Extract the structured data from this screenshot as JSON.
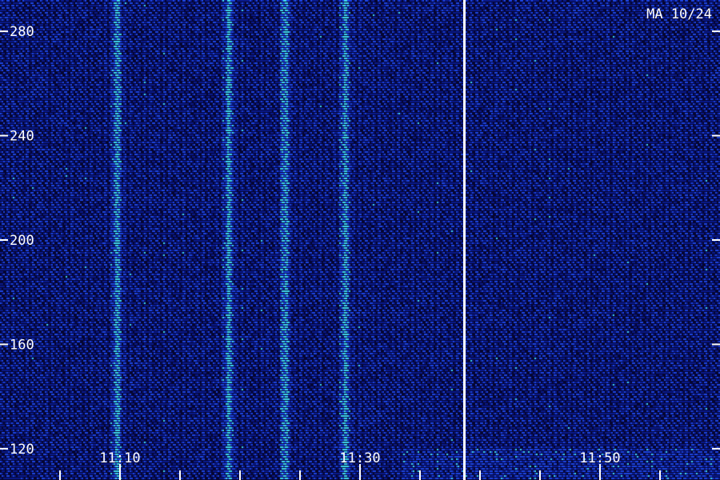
{
  "chart_data": {
    "type": "heatmap",
    "annotation": "MA 10/24",
    "y_axis": {
      "ticks": [
        120,
        160,
        200,
        240,
        280
      ],
      "tick_labels": [
        "120",
        "160",
        "200",
        "240",
        "280"
      ],
      "range": [
        108,
        292
      ]
    },
    "x_axis": {
      "ticks_min": [
        10,
        30,
        50
      ],
      "tick_labels": [
        "11:10",
        "11:30",
        "11:50"
      ],
      "range_min": [
        0,
        60
      ],
      "minor_tick_step_min": 5
    },
    "data_gap_at_min": 38.7,
    "bright_bands_min": [
      9.7,
      19.0,
      23.7,
      28.7
    ],
    "colors": {
      "background": "#050530",
      "low": "#0a1a8c",
      "mid": "#1e46e6",
      "high": "#3fd8f0",
      "axis": "#ffffff"
    }
  }
}
